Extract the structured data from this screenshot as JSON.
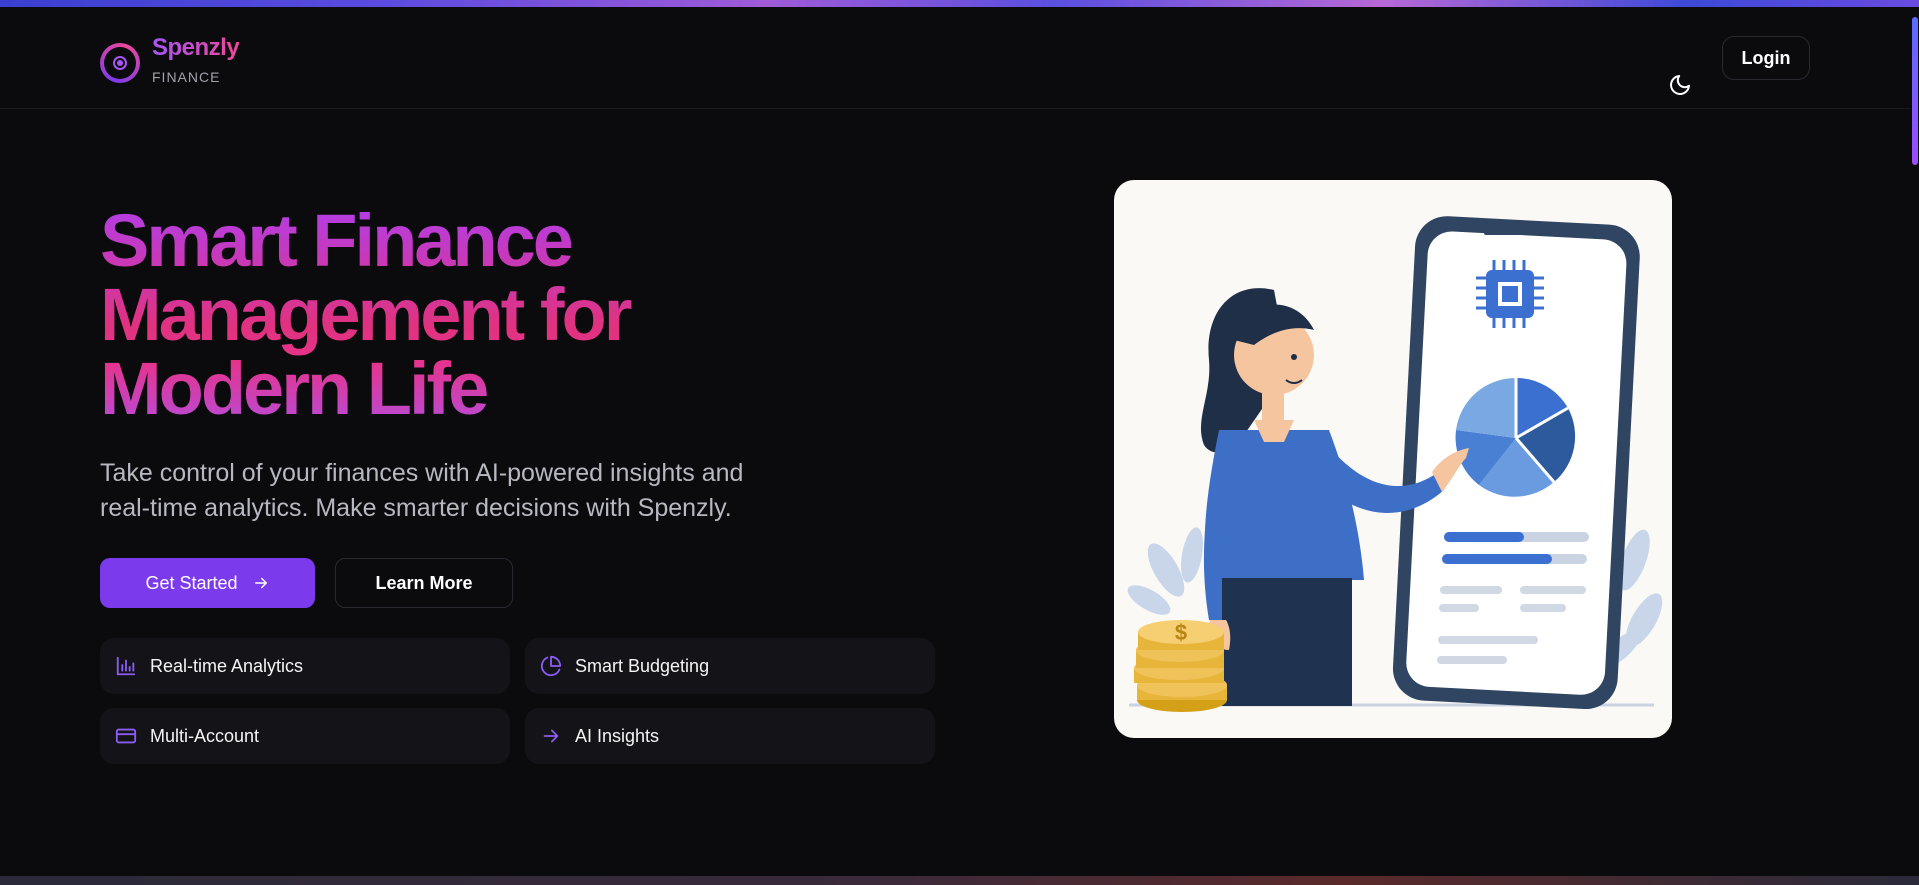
{
  "header": {
    "brand_name": "Spenzly",
    "brand_sub": "FINANCE",
    "login_label": "Login"
  },
  "hero": {
    "title_line1": "Smart Finance",
    "title_line2": "Management for",
    "title_line3": "Modern Life",
    "description_line1": "Take control of your finances with AI-powered insights and",
    "description_line2": "real-time analytics. Make smarter decisions with Spenzly.",
    "primary_button": "Get Started",
    "secondary_button": "Learn More"
  },
  "features": [
    {
      "label": "Real-time Analytics",
      "icon": "bar-chart-icon"
    },
    {
      "label": "Smart Budgeting",
      "icon": "pie-chart-icon"
    },
    {
      "label": "Multi-Account",
      "icon": "credit-card-icon"
    },
    {
      "label": "AI Insights",
      "icon": "arrow-right-icon"
    }
  ],
  "colors": {
    "accent": "#7c3aed",
    "gradient_start": "#a855f7",
    "gradient_end": "#ec4899",
    "background": "#0b0a0d"
  }
}
